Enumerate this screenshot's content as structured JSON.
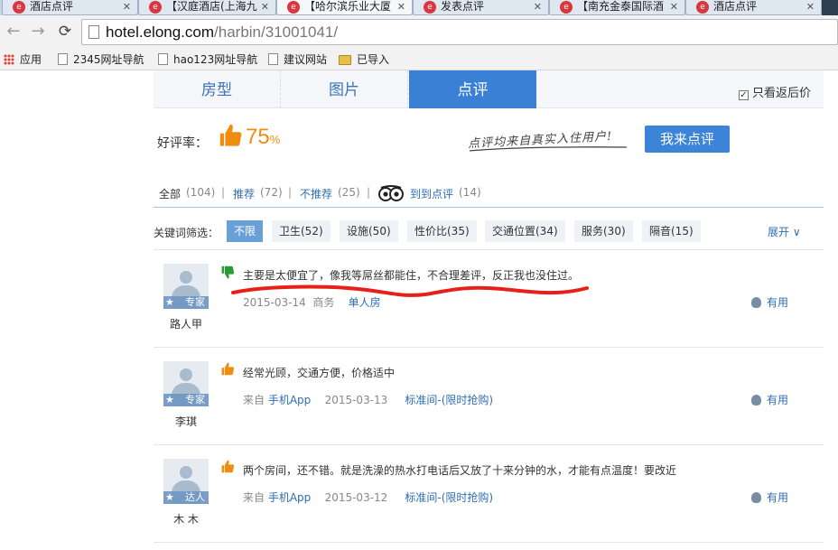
{
  "browser": {
    "tabs": [
      {
        "title": "酒店点评",
        "active": false
      },
      {
        "title": "【汉庭酒店(上海九",
        "active": false
      },
      {
        "title": "【哈尔滨乐业大厦",
        "active": true
      },
      {
        "title": "发表点评",
        "active": false
      },
      {
        "title": "【南充金泰国际酒",
        "active": false
      },
      {
        "title": "酒店点评",
        "active": false
      }
    ],
    "url_host": "hotel.elong.com",
    "url_path": "/harbin/31001041/",
    "bookmarks": [
      "应用",
      "2345网址导航",
      "hao123网址导航",
      "建议网站",
      "已导入"
    ]
  },
  "page": {
    "tabs": [
      "房型",
      "图片",
      "点评"
    ],
    "active_tab": "点评",
    "only_after_checkin": "只看返后价",
    "good_rate_label": "好评率：",
    "good_rate_value": "75",
    "good_rate_unit": "%",
    "slogan": "点评均来自真实入住用户!",
    "write_review_button": "我来点评",
    "filters": {
      "all_label": "全部",
      "all_count": "(104)",
      "recommend_label": "推荐",
      "recommend_count": "(72)",
      "not_recommend_label": "不推荐",
      "not_recommend_count": "(25)",
      "tripadvisor_label": "到到点评",
      "tripadvisor_count": "(14)",
      "separator": "|"
    },
    "keyword_label": "关键词筛选：",
    "keywords": [
      "不限",
      "卫生(52)",
      "设施(50)",
      "性价比(35)",
      "交通位置(34)",
      "服务(30)",
      "隔音(15)"
    ],
    "expand_label": "展开 ∨",
    "reviews": [
      {
        "name": "路人甲",
        "badge": "专家",
        "sentiment": "down",
        "text": "主要是太便宜了，像我等屌丝都能住，不合理差评，反正我也没住过。",
        "source_prefix": "",
        "source": "",
        "date": "2015-03-14",
        "trip_type": "商务",
        "room": "单人房",
        "helpful": "有用"
      },
      {
        "name": "李琪",
        "badge": "专家",
        "sentiment": "up",
        "text": "经常光顾，交通方便，价格适中",
        "source_prefix": "来自",
        "source": "手机App",
        "date": "2015-03-13",
        "trip_type": "",
        "room": "标准间-(限时抢购)",
        "helpful": "有用"
      },
      {
        "name": "木 木",
        "badge": "达人",
        "sentiment": "up",
        "text": "两个房间，还不错。就是洗澡的热水打电话后又放了十来分钟的水，才能有点温度！要改近",
        "source_prefix": "来自",
        "source": "手机App",
        "date": "2015-03-12",
        "trip_type": "",
        "room": "标准间-(限时抢购)",
        "helpful": "有用"
      }
    ]
  },
  "colors": {
    "accent": "#3a80d4",
    "orange": "#f08c10",
    "link": "#2f6db5",
    "scribble": "#e8201a",
    "thumb_down": "#2a9a35"
  }
}
